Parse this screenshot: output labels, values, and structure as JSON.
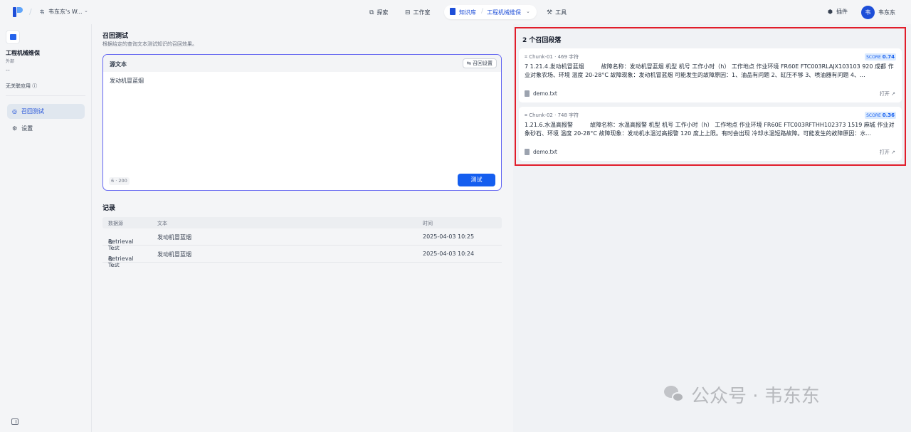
{
  "topbar": {
    "workspace_avatar": "韦",
    "workspace_name": "韦东东's W...",
    "nav": {
      "explore": "探索",
      "studio": "工作室",
      "knowledge": "知识库",
      "current_kb": "工程机械维保",
      "tools": "工具"
    },
    "plugin": "插件",
    "user_avatar": "韦",
    "user_name": "韦东东"
  },
  "sidebar": {
    "kb_title": "工程机械维保",
    "kb_subtitle": "外部",
    "kb_desc": "--",
    "no_apps": "无关联应用",
    "items": [
      {
        "label": "召回测试",
        "active": true
      },
      {
        "label": "设置",
        "active": false
      }
    ]
  },
  "main": {
    "title": "召回测试",
    "description": "根据给定的查询文本测试知识的召回效果。",
    "query": {
      "label": "源文本",
      "settings_label": "召回设置",
      "text": "发动机冒蓝烟",
      "counter": "6 · 200",
      "test_button": "测试"
    },
    "records": {
      "title": "记录",
      "headers": {
        "source": "数据源",
        "text": "文本",
        "time": "时间"
      },
      "rows": [
        {
          "source": "Retrieval Test",
          "text": "发动机冒蓝烟",
          "time": "2025-04-03 10:25"
        },
        {
          "source": "Retrieval Test",
          "text": "发动机冒蓝烟",
          "time": "2025-04-03 10:24"
        }
      ]
    }
  },
  "results": {
    "title": "2 个召回段落",
    "cards": [
      {
        "chunk": "Chunk-01",
        "chars": "469 字符",
        "score_label": "SCORE",
        "score": "0.74",
        "text": "7 1.21.4.发动机冒蓝烟　　　故障名称：发动机冒蓝烟 机型 机号 工作小时（h） 工作地点 作业环境 FR60E FTC003RLAJX103103 920 成都 作业对象农场、环境 温度 20-28°C 故障现象：发动机冒蓝烟 可能发生的故障原因：1、油品有问题 2、缸压不够 3、喷油器有问题 4、...",
        "file": "demo.txt",
        "open": "打开 ↗"
      },
      {
        "chunk": "Chunk-02",
        "chars": "748 字符",
        "score_label": "SCORE",
        "score": "0.36",
        "text": "1.21.6.水温高报警　　　故障名称：水温高报警 机型 机号 工作小时（h） 工作地点 作业环境 FR60E FTC003RFTHH102373 1519 麻城 作业对象砂石、环境 温度 20-28°C 故障现象：发动机水温过高报警 120 度上上限。有时会出现 冷却水温短路故障。可能发生的故障原因：水...",
        "file": "demo.txt",
        "open": "打开 ↗"
      }
    ]
  },
  "watermark": "公众号 · 韦东东",
  "colors": {
    "accent": "#155eef",
    "highlight_border": "#e11d2a",
    "query_border": "#6366f1"
  }
}
